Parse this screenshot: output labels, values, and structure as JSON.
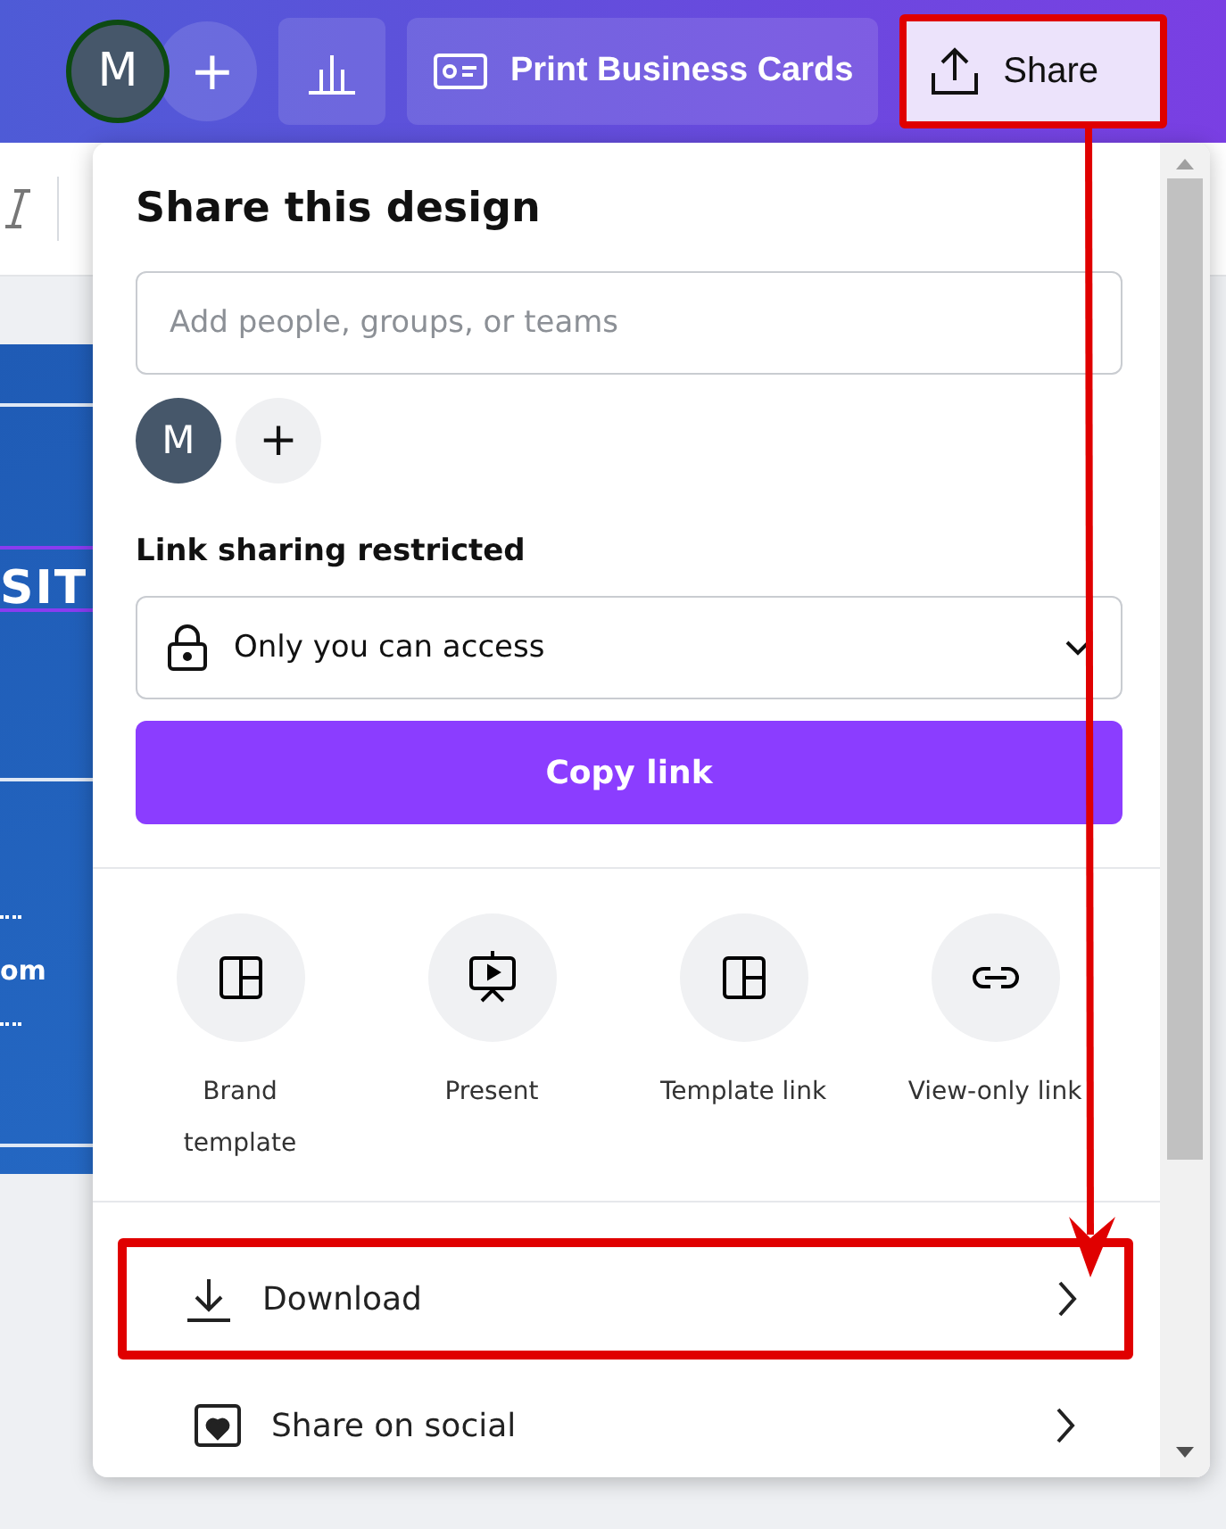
{
  "top_bar": {
    "avatar": "M",
    "add": "+",
    "print_button": "Print Business Cards",
    "share_button": {
      "label": "Share",
      "highlighted": true
    }
  },
  "canvas": {
    "texts": [
      "SIT",
      "om"
    ]
  },
  "share_panel": {
    "title": "Share this design",
    "search": {
      "placeholder": "Add people, groups, or teams"
    },
    "collaborators": [
      {
        "initial": "M"
      }
    ],
    "add": "+",
    "link_heading": "Link sharing restricted",
    "access": {
      "value": "Only you can access"
    },
    "copy_button": "Copy link",
    "options": [
      {
        "label": "Brand template",
        "kind": "template"
      },
      {
        "label": "Present",
        "kind": "present"
      },
      {
        "label": "Template link",
        "kind": "template"
      },
      {
        "label": "View-only link",
        "kind": "link"
      }
    ],
    "rows": [
      {
        "label": "Download",
        "kind": "download",
        "highlighted": true
      },
      {
        "label": "Share on social",
        "kind": "social",
        "highlighted": false
      }
    ]
  }
}
